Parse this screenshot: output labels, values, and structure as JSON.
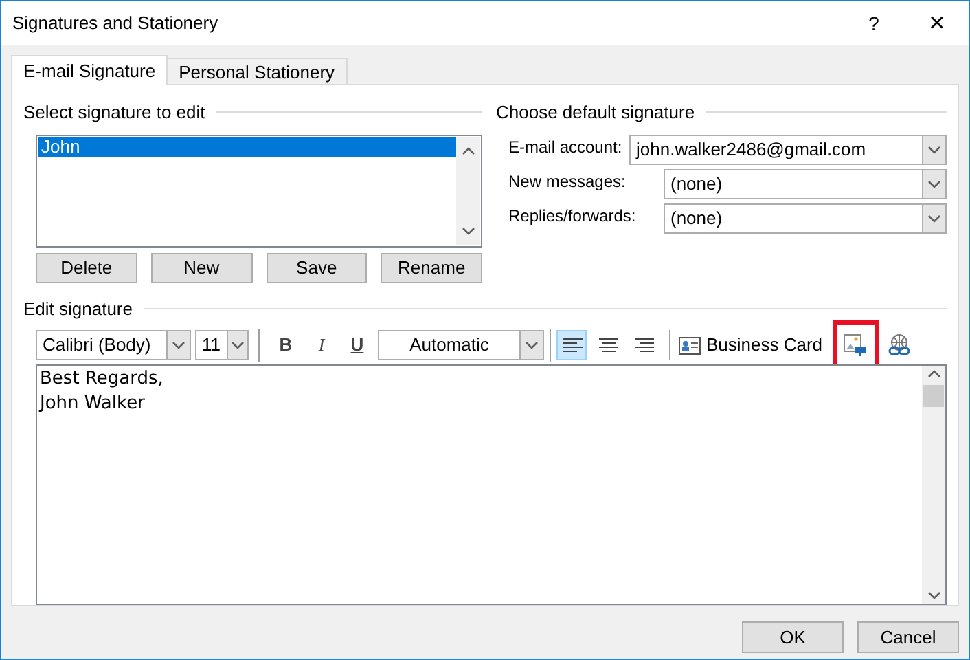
{
  "window": {
    "title": "Signatures and Stationery",
    "help": "?",
    "close": "×"
  },
  "tabs": [
    {
      "label": "E-mail Signature",
      "selected": true
    },
    {
      "label": "Personal Stationery",
      "selected": false
    }
  ],
  "select_signature": {
    "heading": "Select signature to edit",
    "items": [
      {
        "label": "John",
        "selected": true
      }
    ],
    "buttons": [
      "Delete",
      "New",
      "Save",
      "Rename"
    ]
  },
  "default_signature": {
    "heading": "Choose default signature",
    "fields": [
      {
        "label": "E-mail account:",
        "value": "john.walker2486@gmail.com"
      },
      {
        "label": "New messages:",
        "value": "(none)"
      },
      {
        "label": "Replies/forwards:",
        "value": "(none)"
      }
    ]
  },
  "edit_signature": {
    "heading": "Edit signature",
    "font": "Calibri (Body)",
    "size": "11",
    "bold": "B",
    "italic": "I",
    "underline": "U",
    "font_color_label": "Automatic",
    "alignments": [
      {
        "kind": "left",
        "selected": true
      },
      {
        "kind": "center",
        "selected": false
      },
      {
        "kind": "right",
        "selected": false
      }
    ],
    "business_card": "Business Card",
    "picture_button": {
      "highlighted": true
    },
    "lines": [
      "Best Regards,",
      "John Walker"
    ]
  },
  "buttons": [
    "OK",
    "Cancel"
  ]
}
